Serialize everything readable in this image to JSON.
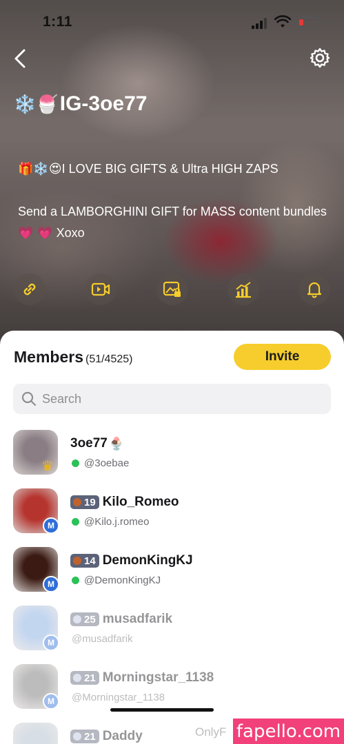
{
  "status_bar": {
    "time": "1:11"
  },
  "group": {
    "title_emoji": "❄️🍧",
    "title": "IG-3oe77",
    "bio_line1_emoji": "🎁❄️😍",
    "bio_line1": "I LOVE BIG GIFTS & Ultra HIGH ZAPS",
    "bio_line2": "Send a LAMBORGHINI GIFT for MASS content bundles",
    "bio_line2_emoji": " 💗 💗",
    "bio_line2_end": "Xoxo"
  },
  "actions": [
    "link-icon",
    "video-icon",
    "locked-image-icon",
    "stats-icon",
    "bell-icon"
  ],
  "members": {
    "title": "Members",
    "count": "(51/4525)",
    "invite_label": "Invite",
    "search_placeholder": "Search",
    "list": [
      {
        "name": "3oe77",
        "emoji": "🍨",
        "handle": "@3oebae",
        "level": "",
        "badge": "crown",
        "online": true,
        "dim": false,
        "avatar_color": "#8a7e84"
      },
      {
        "name": "Kilo_Romeo",
        "emoji": "",
        "handle": "@Kilo.j.romeo",
        "level": "19",
        "badge": "M",
        "online": true,
        "dim": false,
        "avatar_color": "#b6342e"
      },
      {
        "name": "DemonKingKJ",
        "emoji": "",
        "handle": "@DemonKingKJ",
        "level": "14",
        "badge": "M",
        "online": true,
        "dim": false,
        "avatar_color": "#3a1a12"
      },
      {
        "name": "musadfarik",
        "emoji": "",
        "handle": "@musadfarik",
        "level": "25",
        "badge": "M",
        "online": false,
        "dim": true,
        "avatar_color": "#7aa5e0"
      },
      {
        "name": "Morningstar_1138",
        "emoji": "",
        "handle": "@Morningstar_1138",
        "level": "21",
        "badge": "M",
        "online": false,
        "dim": true,
        "avatar_color": "#6d6d6d"
      },
      {
        "name": "Daddy",
        "emoji": "",
        "handle": "",
        "level": "21",
        "badge": "",
        "online": false,
        "dim": true,
        "avatar_color": "#a8b8c8"
      }
    ]
  },
  "watermark": {
    "faint": "OnlyF",
    "label": "fapello.com"
  },
  "colors": {
    "accent": "#f6cd2c",
    "online": "#2cc158",
    "m_badge": "#2f6ed8",
    "level_badge": "#5c6378",
    "watermark": "#f1407a"
  }
}
